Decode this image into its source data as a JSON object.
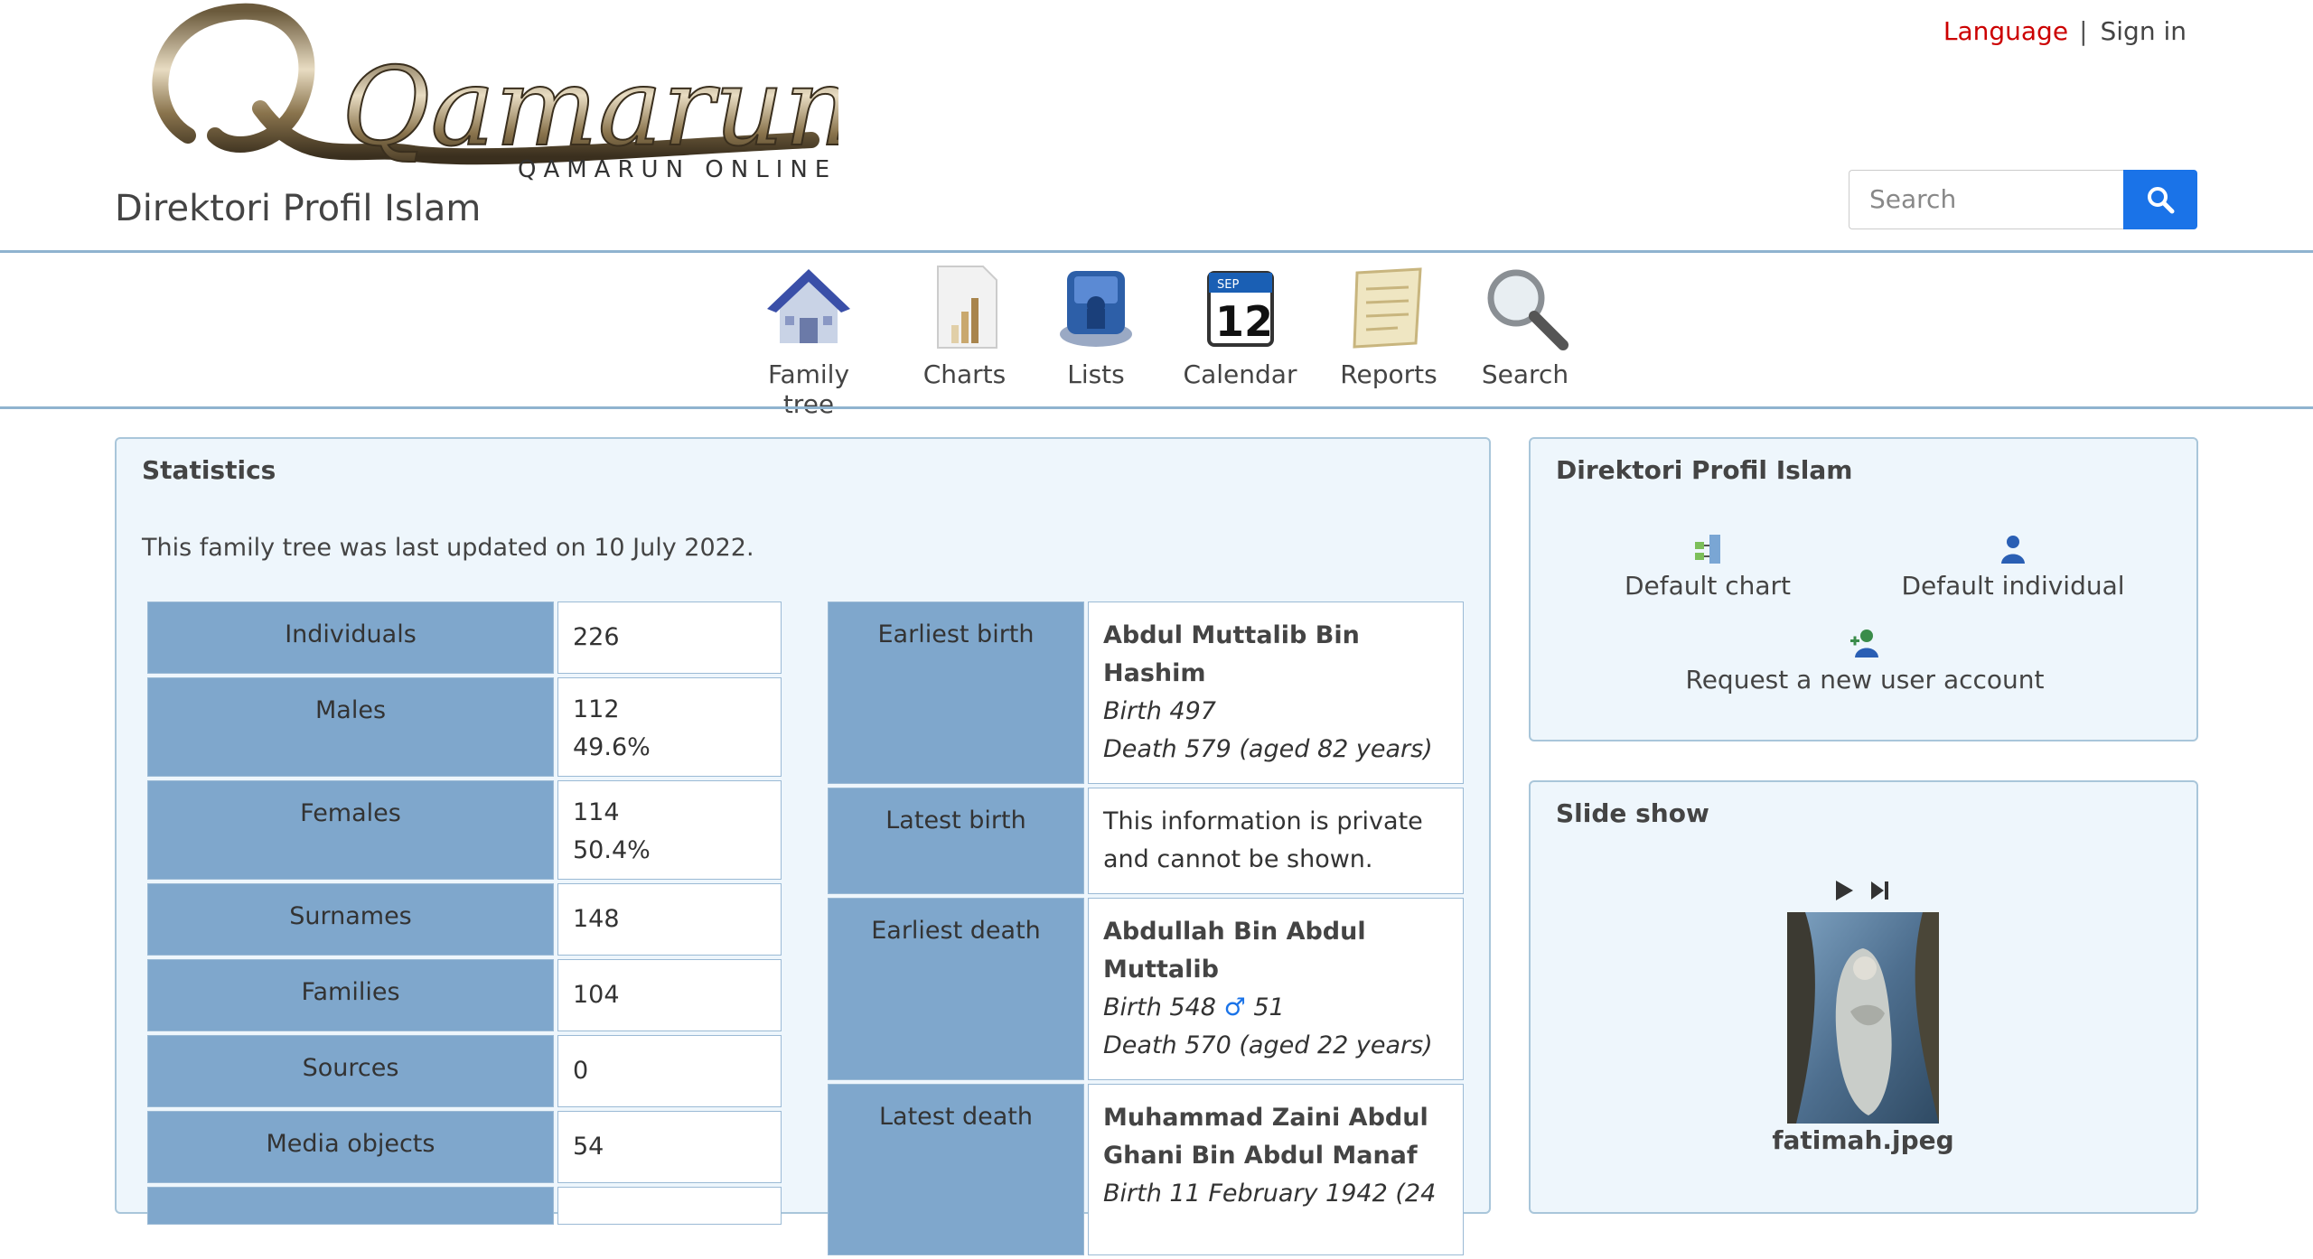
{
  "header": {
    "logo_text": "Qamarun",
    "logo_subtext": "QAMARUN ONLINE",
    "site_title": "Direktori Profil Islam",
    "language_label": "Language",
    "separator": "|",
    "signin_label": "Sign in",
    "search_placeholder": "Search"
  },
  "menu": [
    {
      "label": "Family tree",
      "icon": "house-icon"
    },
    {
      "label": "Charts",
      "icon": "chart-icon"
    },
    {
      "label": "Lists",
      "icon": "lists-icon"
    },
    {
      "label": "Calendar",
      "icon": "calendar-icon",
      "day": "12",
      "month": "SEP"
    },
    {
      "label": "Reports",
      "icon": "scroll-icon"
    },
    {
      "label": "Search",
      "icon": "magnifier-icon"
    }
  ],
  "statistics": {
    "title": "Statistics",
    "updated_text": "This family tree was last updated on 10 July 2022.",
    "rows": [
      {
        "label": "Individuals",
        "value": "226",
        "pct": ""
      },
      {
        "label": "Males",
        "value": "112",
        "pct": "49.6%"
      },
      {
        "label": "Females",
        "value": "114",
        "pct": "50.4%"
      },
      {
        "label": "Surnames",
        "value": "148",
        "pct": ""
      },
      {
        "label": "Families",
        "value": "104",
        "pct": ""
      },
      {
        "label": "Sources",
        "value": "0",
        "pct": ""
      },
      {
        "label": "Media objects",
        "value": "54",
        "pct": ""
      }
    ],
    "events": {
      "earliest_birth": {
        "label": "Earliest birth",
        "name": "Abdul Muttalib Bin Hashim",
        "birth_word": "Birth",
        "birth_val": "497",
        "death_word": "Death",
        "death_val": "579",
        "death_age": "(aged 82 years)"
      },
      "latest_birth": {
        "label": "Latest birth",
        "text": "This information is private and cannot be shown."
      },
      "earliest_death": {
        "label": "Earliest death",
        "name": "Abdullah Bin Abdul Muttalib",
        "birth_word": "Birth",
        "birth_val": "548",
        "male_symbol": "♂",
        "birth_age": "51",
        "death_word": "Death",
        "death_val": "570",
        "death_age": "(aged 22 years)"
      },
      "latest_death": {
        "label": "Latest death",
        "name": "Muhammad Zaini Abdul Ghani Bin Abdul Manaf",
        "birth_word": "Birth",
        "birth_val": "11 February 1942",
        "birth_age": "(24"
      }
    }
  },
  "directory": {
    "title": "Direktori Profil Islam",
    "default_chart": "Default chart",
    "default_individual": "Default individual",
    "request_account": "Request a new user account"
  },
  "slideshow": {
    "title": "Slide show",
    "caption": "fatimah.jpeg"
  },
  "colors": {
    "accent": "#1a73e8",
    "language": "#cc0000",
    "header_cell": "#7fa7cc",
    "card_bg": "#eef6fc",
    "card_border": "#a9c6da"
  }
}
